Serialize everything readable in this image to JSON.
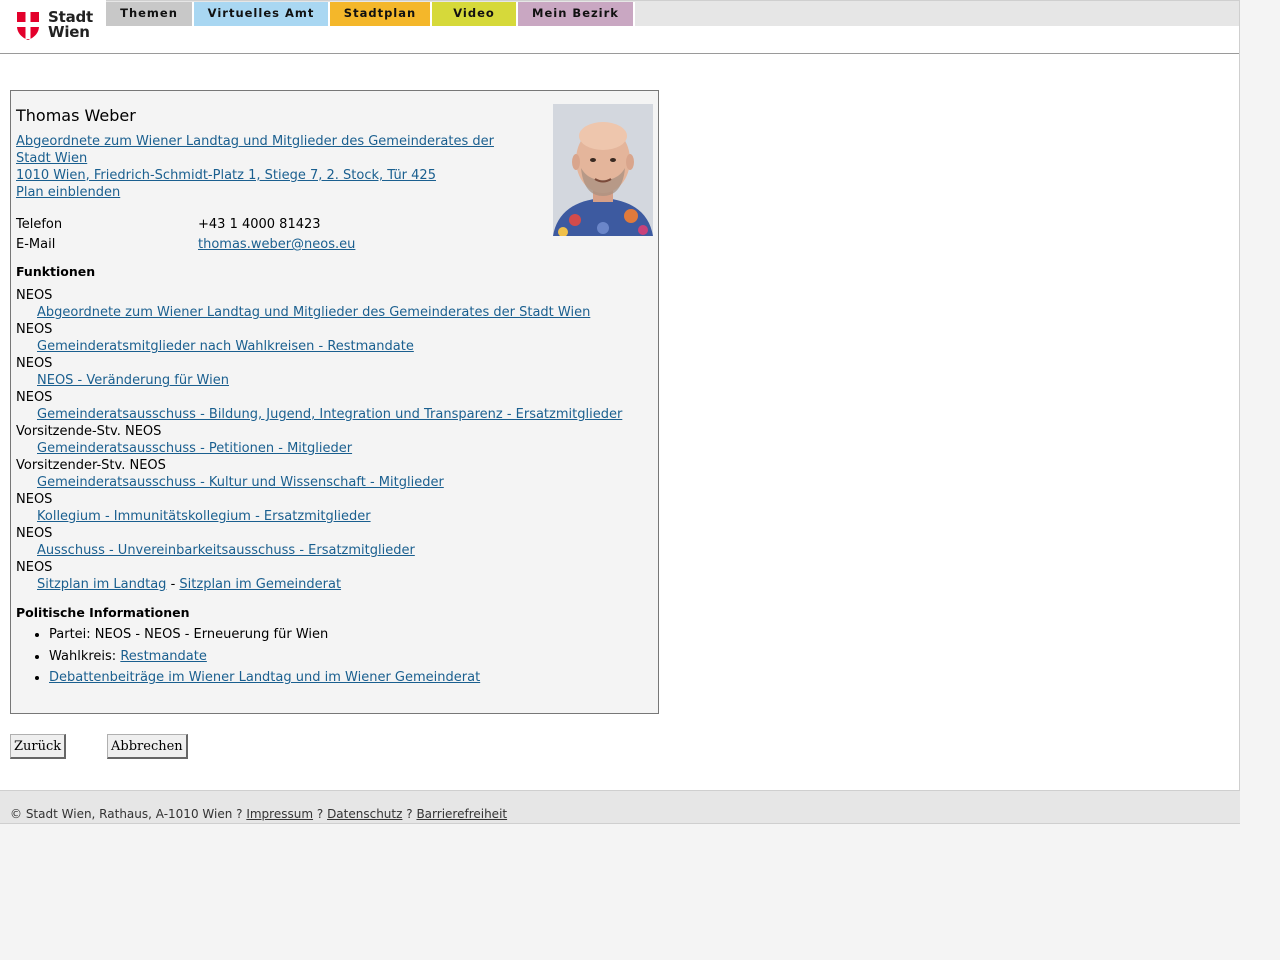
{
  "header": {
    "logo_line1": "Stadt",
    "logo_line2": "Wien",
    "tabs": [
      {
        "label": "Themen",
        "color": "#c8c8c8"
      },
      {
        "label": "Virtuelles Amt",
        "color": "#a9d7f2"
      },
      {
        "label": "Stadtplan",
        "color": "#f4b72a"
      },
      {
        "label": "Video",
        "color": "#d6d93a"
      },
      {
        "label": "Mein Bezirk",
        "color": "#c9a7c2"
      }
    ]
  },
  "person": {
    "name": "Thomas Weber",
    "org_link": "Abgeordnete zum Wiener Landtag und Mitglieder des Gemeinderates der Stadt Wien",
    "address_link": "1010 Wien, Friedrich-Schmidt-Platz 1, Stiege 7, 2. Stock, Tür 425",
    "plan_link": "Plan einblenden",
    "phone_label": "Telefon",
    "phone_value": "+43 1 4000 81423",
    "email_label": "E-Mail",
    "email_value": "thomas.weber@neos.eu"
  },
  "functions": {
    "heading": "Funktionen",
    "items": [
      {
        "role": "NEOS",
        "link": "Abgeordnete zum Wiener Landtag und Mitglieder des Gemeinderates der Stadt Wien"
      },
      {
        "role": "NEOS",
        "link": "Gemeinderatsmitglieder nach Wahlkreisen - Restmandate"
      },
      {
        "role": "NEOS",
        "link": "NEOS - Veränderung für Wien"
      },
      {
        "role": "NEOS",
        "link": "Gemeinderatsausschuss - Bildung, Jugend, Integration und Transparenz - Ersatzmitglieder"
      },
      {
        "role": "Vorsitzende-Stv. NEOS",
        "link": "Gemeinderatsausschuss - Petitionen - Mitglieder"
      },
      {
        "role": "Vorsitzender-Stv. NEOS",
        "link": "Gemeinderatsausschuss - Kultur und Wissenschaft - Mitglieder"
      },
      {
        "role": "NEOS",
        "link": "Kollegium - Immunitätskollegium - Ersatzmitglieder"
      },
      {
        "role": "NEOS",
        "link": "Ausschuss - Unvereinbarkeitsausschuss - Ersatzmitglieder"
      }
    ],
    "last_role": "NEOS",
    "seat_landtag": "Sitzplan im Landtag",
    "seat_sep": "-",
    "seat_gemeinderat": "Sitzplan im Gemeinderat"
  },
  "political": {
    "heading": "Politische Informationen",
    "party": "Partei: NEOS - NEOS - Erneuerung für Wien",
    "district_label": "Wahlkreis:",
    "district_link": "Restmandate",
    "debates_link": "Debattenbeiträge im Wiener Landtag und im Wiener Gemeinderat"
  },
  "buttons": {
    "back": "Zurück",
    "cancel": "Abbrechen"
  },
  "footer": {
    "copyright": "© Stadt Wien, Rathaus, A-1010 Wien ?",
    "impressum": "Impressum",
    "sep1": "?",
    "datenschutz": "Datenschutz",
    "sep2": "?",
    "barrierefreiheit": "Barrierefreiheit"
  }
}
